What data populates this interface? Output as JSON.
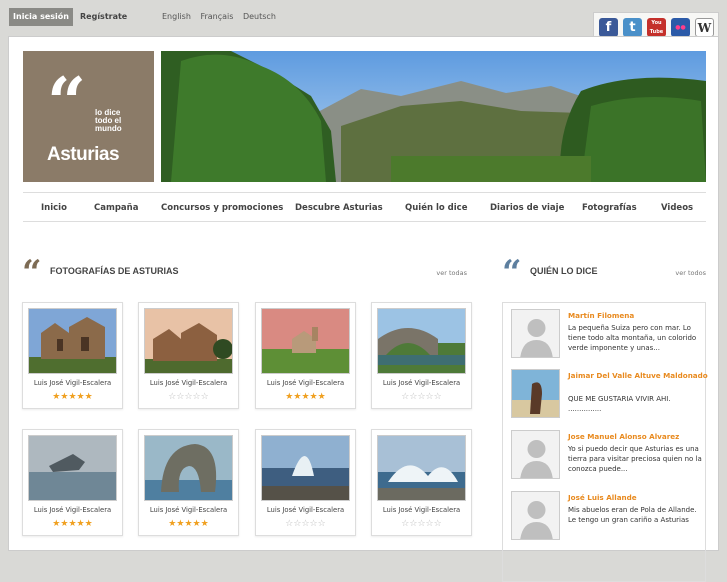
{
  "topbar": {
    "login_label": "Inicia sesión",
    "register_label": "Regístrate",
    "languages": [
      "English",
      "Français",
      "Deutsch"
    ]
  },
  "social": [
    {
      "icon": "facebook-icon",
      "glyph": "f",
      "color": "#3b5998"
    },
    {
      "icon": "twitter-icon",
      "glyph": "t",
      "color": "#4a90c9"
    },
    {
      "icon": "youtube-icon",
      "glyph": "You Tube",
      "color": "#c4302b"
    },
    {
      "icon": "flickr-icon",
      "glyph": "●●",
      "color": "#2b5aa8"
    },
    {
      "icon": "wikipedia-icon",
      "glyph": "W",
      "color": "#ffffff"
    }
  ],
  "logo": {
    "quote": "“",
    "tagline": [
      "lo dice",
      "todo el",
      "mundo"
    ],
    "name": "Asturias"
  },
  "nav": [
    "Inicio",
    "Campaña",
    "Concursos y promociones",
    "Descubre Asturias",
    "Quién lo dice",
    "Diarios de viaje",
    "Fotografías",
    "Videos"
  ],
  "photos_section": {
    "title": "FOTOGRAFÍAS DE ASTURIAS",
    "see_all": "ver todas",
    "items": [
      {
        "author": "Luis José Vigil-Escalera",
        "rating": 5,
        "max": 5
      },
      {
        "author": "Luis José Vigil-Escalera",
        "rating": 0,
        "max": 5
      },
      {
        "author": "Luis José Vigil-Escalera",
        "rating": 5,
        "max": 5
      },
      {
        "author": "Luis José Vigil-Escalera",
        "rating": 0,
        "max": 5
      },
      {
        "author": "Luis José Vigil-Escalera",
        "rating": 5,
        "max": 5
      },
      {
        "author": "Luis José Vigil-Escalera",
        "rating": 5,
        "max": 5
      },
      {
        "author": "Luis José Vigil-Escalera",
        "rating": 0,
        "max": 5
      },
      {
        "author": "Luis José Vigil-Escalera",
        "rating": 0,
        "max": 5
      }
    ]
  },
  "who_section": {
    "title": "QUIÉN LO DICE",
    "see_all": "ver todos",
    "entries": [
      {
        "name": "Martín Filomena",
        "text": "La pequeña Suiza pero con mar. Lo tiene todo alta montaña, un colorido verde imponente y unas..."
      },
      {
        "name": "Jaimar Del Valle Altuve Maldonado",
        "text": "QUE ME GUSTARIA VIVIR AHI. ..............."
      },
      {
        "name": "Jose Manuel Alonso Alvarez",
        "text": "Yo si puedo decir que Asturias es una tierra para visitar preciosa quien no la conozca puede..."
      },
      {
        "name": "José Luis Allande",
        "text": "Mis abuelos eran de Pola de Allande. Le tengo un gran cariño a Asturias"
      }
    ]
  },
  "colors": {
    "accent": "#e88a1f",
    "brand_brown": "#8b7b68",
    "star": "#f0a020"
  }
}
